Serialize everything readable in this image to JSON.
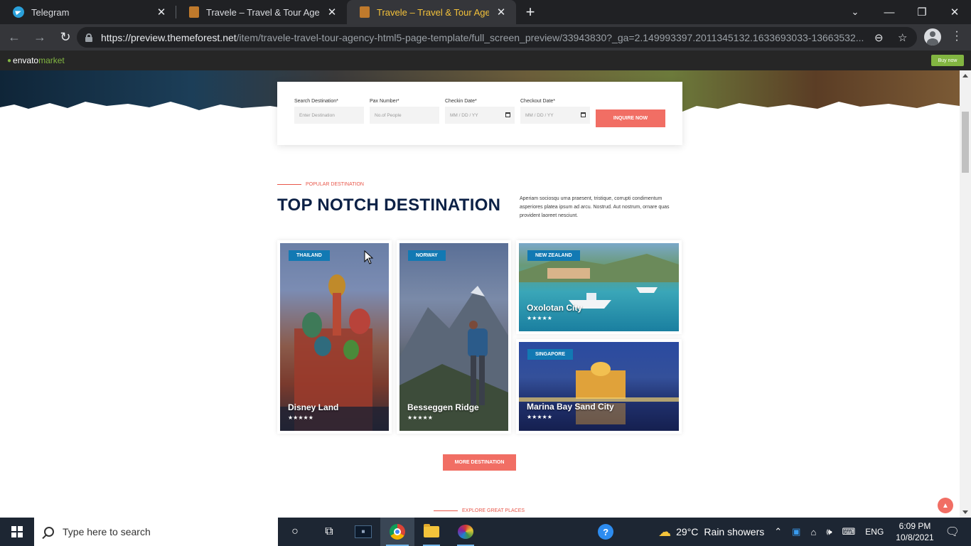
{
  "browser": {
    "tabs": [
      {
        "title": "Telegram",
        "active": false,
        "icon": "telegram-icon"
      },
      {
        "title": "Travele – Travel & Tour Agency H",
        "active": false,
        "icon": "travele-favicon-icon"
      },
      {
        "title": "Travele – Travel & Tour Agency H",
        "active": true,
        "icon": "travele-favicon-icon"
      }
    ],
    "new_tab_label": "+",
    "url_host": "https://preview.themeforest.net",
    "url_path": "/item/travele-travel-tour-agency-html5-page-template/full_screen_preview/33943830?_ga=2.149993397.2011345132.1633693033-13663532..."
  },
  "envato": {
    "logo_text": "envato",
    "logo_market": "market",
    "buy_now": "Buy now",
    "accent": "#82b541"
  },
  "booking": {
    "fields": [
      {
        "label": "Search Destination*",
        "placeholder": "Enter Destination"
      },
      {
        "label": "Pax Number*",
        "placeholder": "No.of People"
      },
      {
        "label": "Checkin Date*",
        "placeholder": "MM / DD / YY"
      },
      {
        "label": "Checkout Date*",
        "placeholder": "MM / DD / YY"
      }
    ],
    "submit": "INQUIRE NOW"
  },
  "section": {
    "eyebrow": "POPULAR DESTINATION",
    "title": "TOP NOTCH DESTINATION",
    "description": "Aperiam sociosqu urna praesent, tristique, corrupti condimentum asperiores platea ipsum ad arcu. Nostrud. Aut nostrum, ornare quas provident laoreet nesciunt."
  },
  "destinations": [
    {
      "tag": "THAILAND",
      "name": "Disney Land",
      "stars": "★★★★★"
    },
    {
      "tag": "NORWAY",
      "name": "Besseggen Ridge",
      "stars": "★★★★★"
    },
    {
      "tag": "NEW ZEALAND",
      "name": "Oxolotan City",
      "stars": "★★★★★"
    },
    {
      "tag": "SINGAPORE",
      "name": "Marina Bay Sand City",
      "stars": "★★★★★"
    }
  ],
  "more_button": "MORE DESTINATION",
  "next_eyebrow": "EXPLORE GREAT PLACES",
  "accent_color": "#f16e64",
  "tag_color": "#1279b3",
  "taskbar": {
    "search_placeholder": "Type here to search",
    "weather_temp": "29°C",
    "weather_text": "Rain showers",
    "language": "ENG",
    "time": "6:09 PM",
    "date": "10/8/2021"
  }
}
